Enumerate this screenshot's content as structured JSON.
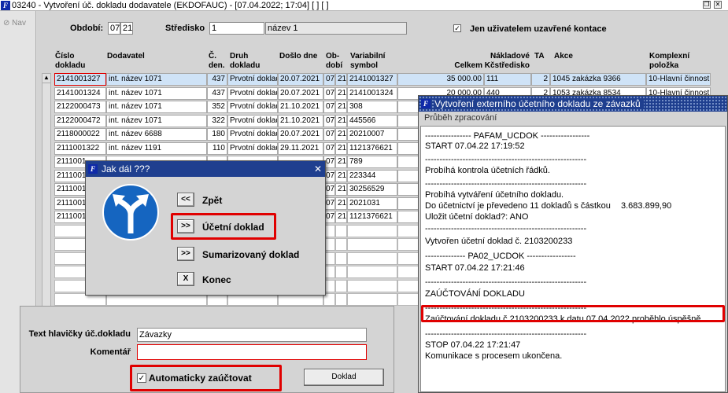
{
  "window": {
    "title": "03240 - Vytvoření úč. dokladu dodavatele (EKDOFAUC) - [07.04.2022; 17:04]  [ ]  [ ]",
    "app_icon_letter": "F",
    "nav_label": "Nav"
  },
  "filters": {
    "obdobi_label": "Období:",
    "obdobi_month": "07",
    "obdobi_year": "21",
    "stredisko_label": "Středisko",
    "stredisko_value": "1",
    "stredisko_name": "název 1",
    "only_closed_checked": "✓",
    "only_closed_label": "Jen uživatelem uzavřené kontace"
  },
  "table": {
    "headers": {
      "cislo": [
        "Číslo",
        "dokladu"
      ],
      "dodavatel": [
        "",
        "Dodavatel"
      ],
      "cden": [
        "Č.",
        "den."
      ],
      "druh": [
        "Druh",
        "dokladu"
      ],
      "doslo": [
        "",
        "Došlo dne"
      ],
      "obdobi": [
        "Ob-",
        "dobí"
      ],
      "variabilni": [
        "Variabilní",
        "symbol"
      ],
      "nakladove": [
        "Nákladové",
        "Celkem Kčstředisko"
      ],
      "ta": [
        "",
        "TA"
      ],
      "akce": [
        "",
        "Akce"
      ],
      "komplexni": [
        "Komplexní",
        "položka"
      ]
    },
    "rows": [
      {
        "cislo": "2141001327",
        "dodavatel": "int. název 1071",
        "cden": "437",
        "druh": "Prvotní doklad",
        "doslo": "20.07.2021",
        "m": "07",
        "y": "21",
        "vs": "2141001327",
        "celkem": "35 000.00",
        "stredisko": "111",
        "ta": "2",
        "akce": "1045 zakázka 9366",
        "komplex": "10-Hlavní činnost"
      },
      {
        "cislo": "2141001324",
        "dodavatel": "int. název 1071",
        "cden": "437",
        "druh": "Prvotní doklad",
        "doslo": "20.07.2021",
        "m": "07",
        "y": "21",
        "vs": "2141001324",
        "celkem": "20 000.00",
        "stredisko": "440",
        "ta": "2",
        "akce": "1053 zakázka 8534",
        "komplex": "10-Hlavní činnost"
      },
      {
        "cislo": "2122000473",
        "dodavatel": "int. název 1071",
        "cden": "352",
        "druh": "Prvotní doklad",
        "doslo": "21.10.2021",
        "m": "07",
        "y": "21",
        "vs": "308"
      },
      {
        "cislo": "2122000472",
        "dodavatel": "int. název 1071",
        "cden": "322",
        "druh": "Prvotní doklad",
        "doslo": "21.10.2021",
        "m": "07",
        "y": "21",
        "vs": "445566"
      },
      {
        "cislo": "2118000022",
        "dodavatel": "int. název 6688",
        "cden": "180",
        "druh": "Prvotní doklad",
        "doslo": "20.07.2021",
        "m": "07",
        "y": "21",
        "vs": "20210007"
      },
      {
        "cislo": "2111001322",
        "dodavatel": "int. název 1191",
        "cden": "110",
        "druh": "Prvotní doklad",
        "doslo": "29.11.2021",
        "m": "07",
        "y": "21",
        "vs": "1121376621"
      },
      {
        "cislo": "2111001",
        "m": "07",
        "y": "21",
        "vs": "789"
      },
      {
        "cislo": "2111001",
        "m": "07",
        "y": "21",
        "vs": "223344"
      },
      {
        "cislo": "2111001",
        "m": "07",
        "y": "21",
        "vs": "30256529"
      },
      {
        "cislo": "2111001",
        "m": "07",
        "y": "21",
        "vs": "2021031"
      },
      {
        "cislo": "2111001",
        "m": "07",
        "y": "21",
        "vs": "1121376621"
      }
    ]
  },
  "dialog_jak": {
    "title": "Jak dál ???",
    "close": "✕",
    "options": [
      {
        "btn": "<<",
        "label": "Zpět"
      },
      {
        "btn": ">>",
        "label": "Účetní doklad"
      },
      {
        "btn": ">>",
        "label": "Sumarizovaný doklad"
      },
      {
        "btn": "X",
        "label": "Konec"
      }
    ]
  },
  "dialog_log": {
    "title": "Vytvoření externího účetního dokladu ze závazků",
    "subtitle": "Průběh zpracování",
    "lines": [
      "---------------- PAFAM_UCDOK -----------------",
      "START 07.04.22 17:19:52",
      "--------------------------------------------------------",
      "Probíhá kontrola účetních řádků.",
      "--------------------------------------------------------",
      "Probíhá vytváření účetního dokladu.",
      "Do účetnictví  je převedeno 11 dokladů s částkou",
      " Uložit účetní doklad?: ANO",
      "--------------------------------------------------------",
      "Vytvořen účetní doklad č. 2103200233",
      "-------------- PA02_UCDOK -----------------",
      "START 07.04.22 17:21:46",
      "--------------------------------------------------------",
      "ZAÚČTOVÁNÍ DOKLADU",
      "--------------------------------------------------------",
      "Zaúčtování dokladu č.2103200233 k datu 07.04.2022 proběhlo úspěšně.",
      "--------------------------------------------------------",
      "STOP 07.04.22 17:21:47",
      "Komunikace s procesem ukončena."
    ],
    "amount": "3.683.899,90"
  },
  "bottom_form": {
    "header_label": "Text hlavičky úč.dokladu",
    "header_value": "Závazky",
    "comment_label": "Komentář",
    "comment_value": "",
    "auto_checked": "✓",
    "auto_label": "Automaticky zaúčtovat",
    "doklad_button": "Doklad"
  },
  "colors": {
    "dialog_title_bg": "#1f3f8f",
    "highlight_red": "#e00000",
    "selected_row": "#cfe3f7"
  }
}
